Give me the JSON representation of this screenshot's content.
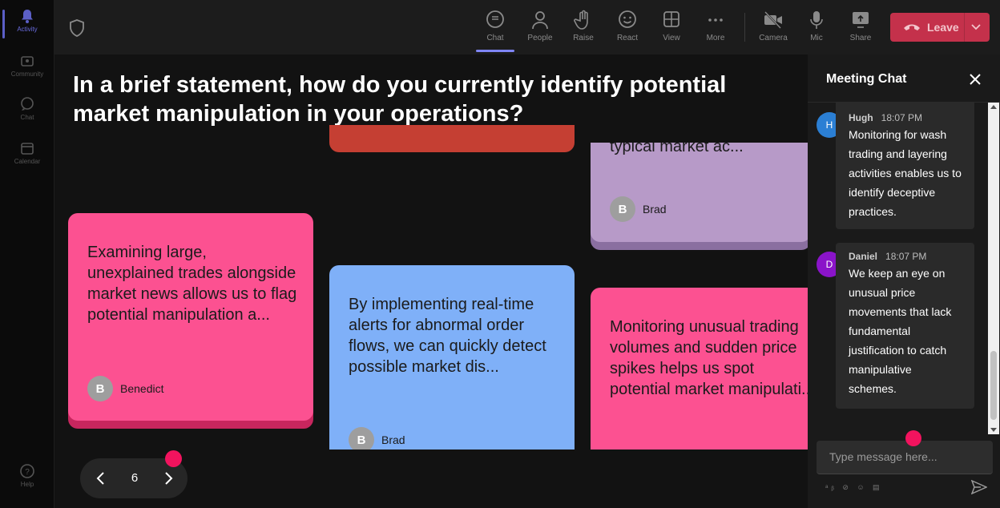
{
  "rail": {
    "items": [
      {
        "label": "Activity",
        "active": true
      },
      {
        "label": "Community"
      },
      {
        "label": "Chat"
      },
      {
        "label": "Calendar"
      }
    ],
    "help": "Help"
  },
  "toolbar": {
    "chat": "Chat",
    "people": "People",
    "raise": "Raise",
    "react": "React",
    "view": "View",
    "more": "More",
    "camera": "Camera",
    "mic": "Mic",
    "share": "Share",
    "leave": "Leave"
  },
  "question": "In a brief statement, how do you currently identify potential market manipulation in your operations?",
  "cards": [
    {
      "text": "",
      "author": "",
      "color": "#c53f33"
    },
    {
      "text": "typical market ac...",
      "author": "Brad",
      "initial": "B",
      "color": "#b79ac8"
    },
    {
      "text": "Examining large, unexplained trades alongside market news allows us to flag potential manipulation a...",
      "author": "Benedict",
      "initial": "B",
      "color": "#fc5191"
    },
    {
      "text": "By implementing real-time alerts for abnormal order flows, we can quickly detect possible market dis...",
      "author": "Brad",
      "initial": "B",
      "color": "#7fb0f8"
    },
    {
      "text": "Monitoring unusual trading volumes and sudden price spikes helps us spot potential market manipulati...",
      "author": "",
      "color": "#fc5191"
    }
  ],
  "pager": {
    "page": "6"
  },
  "chat": {
    "title": "Meeting Chat",
    "messages": [
      {
        "name": "Hugh",
        "initial": "H",
        "time": "18:07 PM",
        "text": "Monitoring for wash trading and layering activities enables us to identify deceptive practices.",
        "avatar_color": "#2b7fd4"
      },
      {
        "name": "Daniel",
        "initial": "D",
        "time": "18:07 PM",
        "text": "We keep an eye on unusual price movements that lack fundamental justification to catch manipulative schemes.",
        "avatar_color": "#8a14c9"
      }
    ],
    "placeholder": "Type message here...",
    "format_tools": "ᵃᵦ ⊘ ☺ ▤"
  },
  "colors": {
    "accent": "#5b5fc7",
    "leave": "#c4314b",
    "notify_dot": "#f2135e"
  }
}
